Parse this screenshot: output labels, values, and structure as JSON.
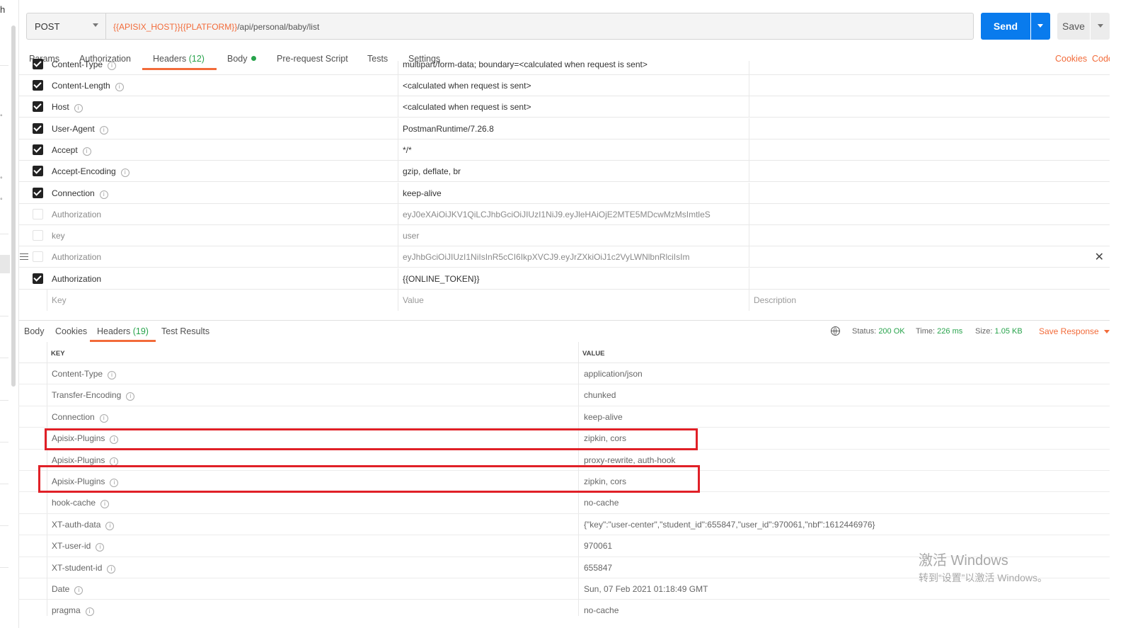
{
  "left_strip": {
    "letter": "h",
    "dots": [
      "°",
      "°",
      "°",
      "°"
    ]
  },
  "request": {
    "method": "POST",
    "url_var1": "{{APISIX_HOST}}",
    "url_var2": "{{PLATFORM}}",
    "url_path": "/api/personal/baby/list",
    "send_label": "Send",
    "save_label": "Save"
  },
  "tabs": {
    "params": "Params",
    "authorization": "Authorization",
    "headers": "Headers",
    "headers_count": "(12)",
    "body": "Body",
    "prerequest": "Pre-request Script",
    "tests": "Tests",
    "settings": "Settings",
    "cookies": "Cookies",
    "code": "Code"
  },
  "request_headers": [
    {
      "key": "Content-Type",
      "value": "multipart/form-data; boundary=<calculated when request is sent>",
      "checked": true,
      "info": true
    },
    {
      "key": "Content-Length",
      "value": "<calculated when request is sent>",
      "checked": true,
      "info": true
    },
    {
      "key": "Host",
      "value": "<calculated when request is sent>",
      "checked": true,
      "info": true
    },
    {
      "key": "User-Agent",
      "value": "PostmanRuntime/7.26.8",
      "checked": true,
      "info": true
    },
    {
      "key": "Accept",
      "value": "*/*",
      "checked": true,
      "info": true
    },
    {
      "key": "Accept-Encoding",
      "value": "gzip, deflate, br",
      "checked": true,
      "info": true
    },
    {
      "key": "Connection",
      "value": "keep-alive",
      "checked": true,
      "info": true
    },
    {
      "key": "Authorization",
      "value": "eyJ0eXAiOiJKV1QiLCJhbGciOiJIUzI1NiJ9.eyJleHAiOjE2MTE5MDcwMzMsImtleS",
      "checked": false,
      "info": false
    },
    {
      "key": "key",
      "value": "user",
      "checked": false,
      "info": false
    },
    {
      "key": "Authorization",
      "value": "eyJhbGciOiJIUzI1NiIsInR5cCI6IkpXVCJ9.eyJrZXkiOiJ1c2VyLWNlbnRlciIsIm",
      "checked": false,
      "info": false
    },
    {
      "key": "Authorization",
      "value": "{{ONLINE_TOKEN}}",
      "checked": true,
      "info": false
    }
  ],
  "new_row": {
    "key": "Key",
    "value": "Value",
    "description": "Description"
  },
  "response": {
    "tabs": {
      "body": "Body",
      "cookies": "Cookies",
      "headers": "Headers",
      "headers_count": "(19)",
      "test_results": "Test Results"
    },
    "status_label": "Status:",
    "status_value": "200 OK",
    "time_label": "Time:",
    "time_value": "226 ms",
    "size_label": "Size:",
    "size_value": "1.05 KB",
    "save_response": "Save Response",
    "col_key": "KEY",
    "col_value": "VALUE",
    "headers": [
      {
        "key": "Content-Type",
        "value": "application/json"
      },
      {
        "key": "Transfer-Encoding",
        "value": "chunked"
      },
      {
        "key": "Connection",
        "value": "keep-alive"
      },
      {
        "key": "Apisix-Plugins",
        "value": "zipkin, cors"
      },
      {
        "key": "Apisix-Plugins",
        "value": "proxy-rewrite, auth-hook"
      },
      {
        "key": "Apisix-Plugins",
        "value": "zipkin, cors"
      },
      {
        "key": "hook-cache",
        "value": "no-cache"
      },
      {
        "key": "XT-auth-data",
        "value": "{\"key\":\"user-center\",\"student_id\":655847,\"user_id\":970061,\"nbf\":1612446976}"
      },
      {
        "key": "XT-user-id",
        "value": "970061"
      },
      {
        "key": "XT-student-id",
        "value": "655847"
      },
      {
        "key": "Date",
        "value": "Sun, 07 Feb 2021 01:18:49 GMT"
      },
      {
        "key": "pragma",
        "value": "no-cache"
      }
    ]
  },
  "watermark": {
    "line1": "激活 Windows",
    "line2": "转到“设置”以激活 Windows。"
  },
  "colors": {
    "accent": "#f26b3a",
    "send": "#097bed",
    "success": "#27a34b",
    "highlight": "#e02027"
  }
}
